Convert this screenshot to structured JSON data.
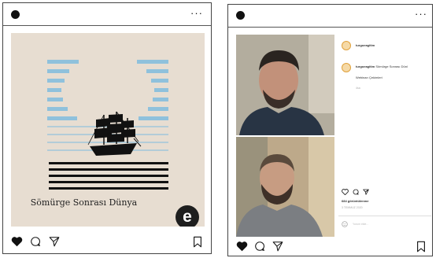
{
  "left_post": {
    "more_label": "···",
    "poster": {
      "title": "Sömürge Sonrası Dünya",
      "logo_letter": "e"
    },
    "icons": {
      "avatar": "avatar-dot",
      "more": "more-icon",
      "like": "heart-filled-icon",
      "comment": "comment-icon",
      "share": "send-icon",
      "save": "bookmark-icon"
    },
    "colors": {
      "poster_background": "#e7ddd1",
      "stripe_blue": "#8fc1dc",
      "stripe_black": "#111111",
      "logo_badge": "#1e1e1e"
    }
  },
  "right_post": {
    "more_label": "···",
    "caption_username": "turgoeagitim",
    "comment": {
      "username": "turgoeagitim",
      "text": "Sömürge Sonrası Dünl",
      "text_line2": "Webinarı Çekimleri",
      "meta": "4sa"
    },
    "likes_label": "684 görüntülenme",
    "timestamp": "3 TEMMUZ 2020",
    "add_comment_placeholder": "Yorum ekle...",
    "icons": {
      "avatar": "avatar-dot",
      "more": "more-icon",
      "like": "heart-filled-icon",
      "comment": "comment-icon",
      "share": "send-icon",
      "save": "bookmark-icon"
    },
    "colors": {
      "avatar_fill": "#f5d9a6",
      "avatar_ring": "#e0a23d"
    }
  }
}
